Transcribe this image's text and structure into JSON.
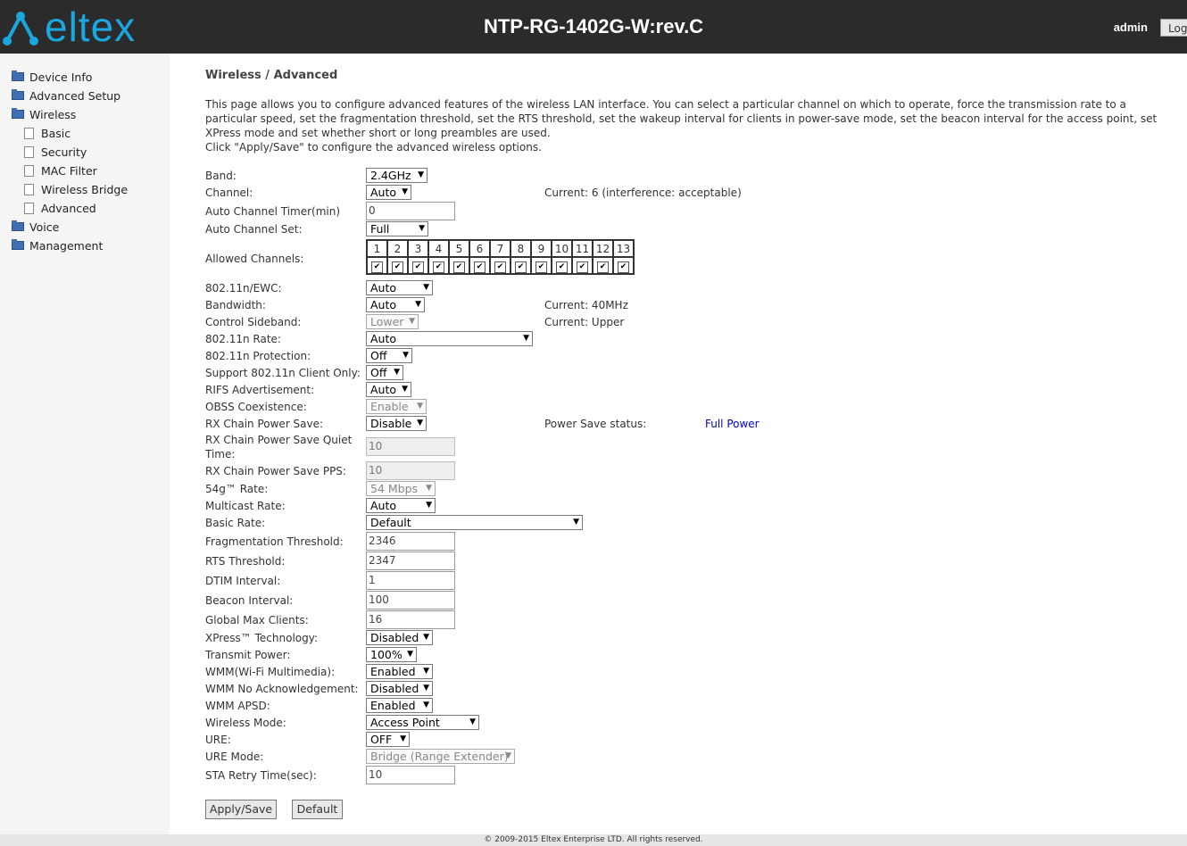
{
  "header": {
    "logo_text": "eltex",
    "device_title": "NTP-RG-1402G-W:rev.C",
    "user": "admin",
    "logout_label": "Log"
  },
  "sidebar": {
    "items": [
      {
        "label": "Device Info",
        "icon": "folder-icon"
      },
      {
        "label": "Advanced Setup",
        "icon": "folder-icon"
      },
      {
        "label": "Wireless",
        "icon": "folder-open-icon"
      },
      {
        "label": "Basic",
        "icon": "page-icon"
      },
      {
        "label": "Security",
        "icon": "page-icon"
      },
      {
        "label": "MAC Filter",
        "icon": "page-icon"
      },
      {
        "label": "Wireless Bridge",
        "icon": "page-icon"
      },
      {
        "label": "Advanced",
        "icon": "page-icon"
      },
      {
        "label": "Voice",
        "icon": "folder-icon"
      },
      {
        "label": "Management",
        "icon": "folder-icon"
      }
    ]
  },
  "main": {
    "title": "Wireless / Advanced",
    "description": "This page allows you to configure advanced features of the wireless LAN interface. You can select a particular channel on which to operate, force the transmission rate to a particular speed, set the fragmentation threshold, set the RTS threshold, set the wakeup interval for clients in power-save mode, set the beacon interval for the access point, set XPress mode and set whether short or long preambles are used.",
    "instruction": "Click \"Apply/Save\" to configure the advanced wireless options."
  },
  "form": {
    "band": {
      "label": "Band:",
      "value": "2.4GHz"
    },
    "channel": {
      "label": "Channel:",
      "value": "Auto",
      "current": "Current: 6 (interference: acceptable)"
    },
    "auto_channel_timer": {
      "label": "Auto Channel Timer(min)",
      "value": "0"
    },
    "auto_channel_set": {
      "label": "Auto Channel Set:",
      "value": "Full"
    },
    "allowed_channels": {
      "label": "Allowed Channels:",
      "channels": [
        "1",
        "2",
        "3",
        "4",
        "5",
        "6",
        "7",
        "8",
        "9",
        "10",
        "11",
        "12",
        "13"
      ],
      "check_mark": "✔"
    },
    "ewc": {
      "label": "802.11n/EWC:",
      "value": "Auto"
    },
    "bandwidth": {
      "label": "Bandwidth:",
      "value": "Auto",
      "current": "Current: 40MHz"
    },
    "control_sideband": {
      "label": "Control Sideband:",
      "value": "Lower",
      "current": "Current: Upper"
    },
    "n_rate": {
      "label": "802.11n Rate:",
      "value": "Auto"
    },
    "n_protection": {
      "label": "802.11n Protection:",
      "value": "Off"
    },
    "n_client_only": {
      "label": "Support 802.11n Client Only:",
      "value": "Off"
    },
    "rifs": {
      "label": "RIFS Advertisement:",
      "value": "Auto"
    },
    "obss": {
      "label": "OBSS Coexistence:",
      "value": "Enable"
    },
    "rx_chain_ps": {
      "label": "RX Chain Power Save:",
      "value": "Disable",
      "status_label": "Power Save status:",
      "status_value": "Full Power"
    },
    "rx_quiet_time": {
      "label": "RX Chain Power Save Quiet Time:",
      "value": "10"
    },
    "rx_pps": {
      "label": "RX Chain Power Save PPS:",
      "value": "10"
    },
    "g_rate": {
      "label": "54g™ Rate:",
      "value": "54 Mbps"
    },
    "multicast_rate": {
      "label": "Multicast Rate:",
      "value": "Auto"
    },
    "basic_rate": {
      "label": "Basic Rate:",
      "value": "Default"
    },
    "frag_threshold": {
      "label": "Fragmentation Threshold:",
      "value": "2346"
    },
    "rts_threshold": {
      "label": "RTS Threshold:",
      "value": "2347"
    },
    "dtim": {
      "label": "DTIM Interval:",
      "value": "1"
    },
    "beacon": {
      "label": "Beacon Interval:",
      "value": "100"
    },
    "max_clients": {
      "label": "Global Max Clients:",
      "value": "16"
    },
    "xpress": {
      "label": "XPress™ Technology:",
      "value": "Disabled"
    },
    "tx_power": {
      "label": "Transmit Power:",
      "value": "100%"
    },
    "wmm": {
      "label": "WMM(Wi-Fi Multimedia):",
      "value": "Enabled"
    },
    "wmm_noack": {
      "label": "WMM No Acknowledgement:",
      "value": "Disabled"
    },
    "wmm_apsd": {
      "label": "WMM APSD:",
      "value": "Enabled"
    },
    "wireless_mode": {
      "label": "Wireless Mode:",
      "value": "Access Point"
    },
    "ure": {
      "label": "URE:",
      "value": "OFF"
    },
    "ure_mode": {
      "label": "URE Mode:",
      "value": "Bridge (Range Extender)"
    },
    "sta_retry": {
      "label": "STA Retry Time(sec):",
      "value": "10"
    }
  },
  "buttons": {
    "apply": "Apply/Save",
    "default": "Default"
  },
  "footer": "© 2009-2015 Eltex Enterprise LTD. All rights reserved.",
  "colors": {
    "header_bg": "#2b2b2b",
    "logo": "#1aa7e0",
    "link": "#0000cc",
    "sidebar_bg": "#f5f5f5"
  }
}
